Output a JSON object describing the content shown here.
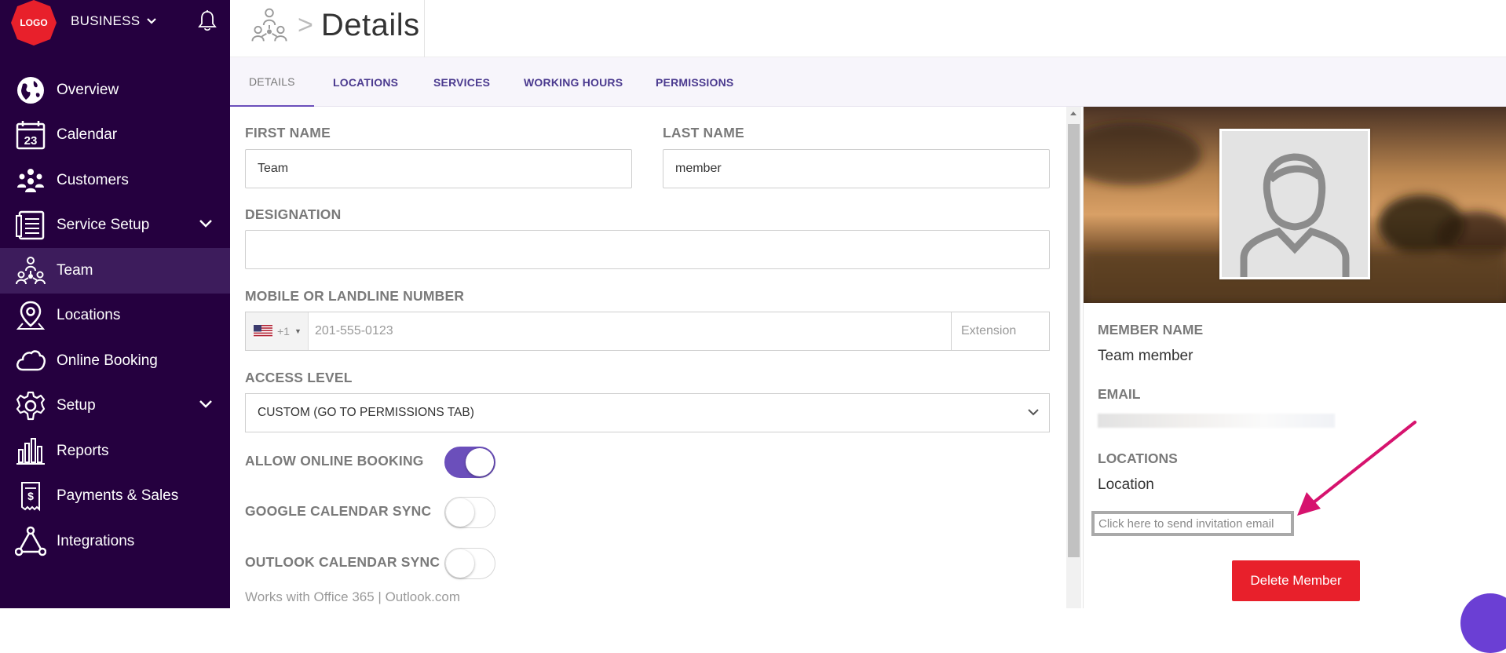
{
  "brand": {
    "logo_text": "LOGO",
    "business_label": "BUSINESS"
  },
  "nav": {
    "items": [
      {
        "label": "Overview"
      },
      {
        "label": "Calendar",
        "icon_text": "23"
      },
      {
        "label": "Customers"
      },
      {
        "label": "Service Setup"
      },
      {
        "label": "Team"
      },
      {
        "label": "Locations"
      },
      {
        "label": "Online Booking"
      },
      {
        "label": "Setup"
      },
      {
        "label": "Reports"
      },
      {
        "label": "Payments & Sales"
      },
      {
        "label": "Integrations"
      }
    ]
  },
  "header": {
    "separator": ">",
    "title": "Details"
  },
  "tabs": [
    {
      "label": "DETAILS"
    },
    {
      "label": "LOCATIONS"
    },
    {
      "label": "SERVICES"
    },
    {
      "label": "WORKING HOURS"
    },
    {
      "label": "PERMISSIONS"
    }
  ],
  "form": {
    "first_name_label": "FIRST NAME",
    "first_name_value": "Team",
    "last_name_label": "LAST NAME",
    "last_name_value": "member",
    "designation_label": "DESIGNATION",
    "designation_value": "",
    "phone_label": "MOBILE OR LANDLINE NUMBER",
    "phone_code": "+1",
    "phone_placeholder": "201-555-0123",
    "extension_placeholder": "Extension",
    "access_label": "ACCESS LEVEL",
    "access_value": "CUSTOM (GO TO PERMISSIONS TAB)",
    "online_booking_label": "ALLOW ONLINE BOOKING",
    "online_booking_on": true,
    "google_sync_label": "GOOGLE CALENDAR SYNC",
    "google_sync_on": false,
    "outlook_sync_label": "OUTLOOK CALENDAR SYNC",
    "outlook_sync_on": false,
    "outlook_note": "Works with Office 365 | Outlook.com"
  },
  "card": {
    "member_name_label": "MEMBER NAME",
    "member_name_value": "Team member",
    "email_label": "EMAIL",
    "locations_label": "LOCATIONS",
    "locations_value": "Location",
    "invite_link": "Click here to send invitation email",
    "delete_button": "Delete Member"
  },
  "colors": {
    "sidebar_bg": "#25003f",
    "accent": "#6b4fbb",
    "delete": "#e8202b",
    "arrow": "#d6136e"
  }
}
